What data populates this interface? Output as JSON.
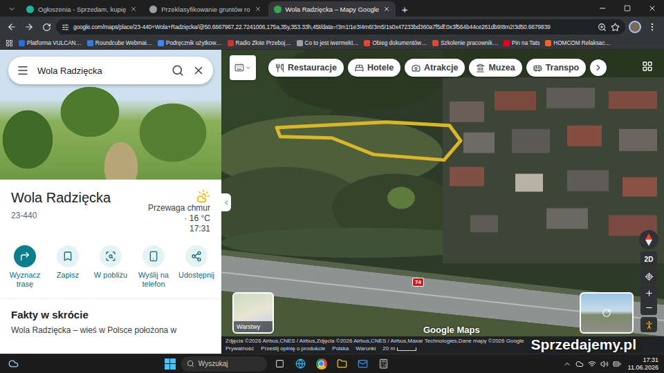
{
  "browser": {
    "tabs": [
      {
        "label": "Ogłoszenia - Sprzedam, kupię",
        "selected": false,
        "color": "#1bb39a"
      },
      {
        "label": "Przeklasyfikowanie gruntów ro",
        "selected": false,
        "color": "#9aa0a6"
      },
      {
        "label": "Wola Radzięcka – Mapy Google",
        "selected": true,
        "color": "#34a853"
      }
    ],
    "new_tab": "+",
    "address": "google.com/maps/place/23-440+Wola+Radzięcka/@50.6667967,22.7241006,175a,35y,353.33h,45t/data=!3m1!1e3!4m6!3m5!1s0x47233bd360a7f5df:0x3f564b44ce261db9!8m2!3d50.6679839",
    "bookmarks": [
      {
        "label": "Platforma VULCAN…",
        "color": "#1a73e8"
      },
      {
        "label": "Roundcube Webmai…",
        "color": "#3a7bd5"
      },
      {
        "label": "Podręcznik użytkow…",
        "color": "#4285f4"
      },
      {
        "label": "Radio Złote Przeboj…",
        "color": "#d93025"
      },
      {
        "label": "Co to jest iwermekt…",
        "color": "#9aa0a6"
      },
      {
        "label": "Obieg dokumentów…",
        "color": "#ea4335"
      },
      {
        "label": "Szkolenie pracownik…",
        "color": "#ea4335"
      },
      {
        "label": "Pin na Tats",
        "color": "#e60023"
      },
      {
        "label": "HOMCOM Relaksac…",
        "color": "#f26522"
      }
    ]
  },
  "place_panel": {
    "search": "Wola Radzięcka",
    "title": "Wola Radzięcka",
    "postal_code": "23-440",
    "weather": {
      "description": "Przewaga chmur",
      "temperature": "· 16 °C",
      "time": "17:31"
    },
    "actions": [
      {
        "label": "Wyznacz trasę",
        "primary": true
      },
      {
        "label": "Zapisz",
        "primary": false
      },
      {
        "label": "W pobliżu",
        "primary": false
      },
      {
        "label": "Wyślij na telefon",
        "primary": false
      },
      {
        "label": "Udostępnij",
        "primary": false
      }
    ],
    "section_title": "Fakty w skrócie",
    "facts": "Wola Radzięcka – wieś w Polsce położona w"
  },
  "map": {
    "categories": [
      "Restauracje",
      "Hotele",
      "Atrakcje",
      "Muzea",
      "Transpo"
    ],
    "road_number": "74",
    "layers_label": "Warstwy",
    "logo": "Google Maps",
    "view_mode": "2D",
    "attribution": "Zdjęcia ©2026 Airbus,CNES / Airbus,Zdjęcia ©2026 Airbus,CNES / Airbus,Maxar Technologies,Dane mapy ©2026 Google",
    "footer_links": [
      "Polska",
      "Warunki"
    ],
    "scale": "20 m",
    "privacy": "Prywatność",
    "feedback": "Prześlij opinię o produkcie"
  },
  "watermark": "Sprzedajemy.pl",
  "taskbar": {
    "search_placeholder": "Wyszukaj",
    "time": "17:31",
    "date": "11.06.2026"
  }
}
